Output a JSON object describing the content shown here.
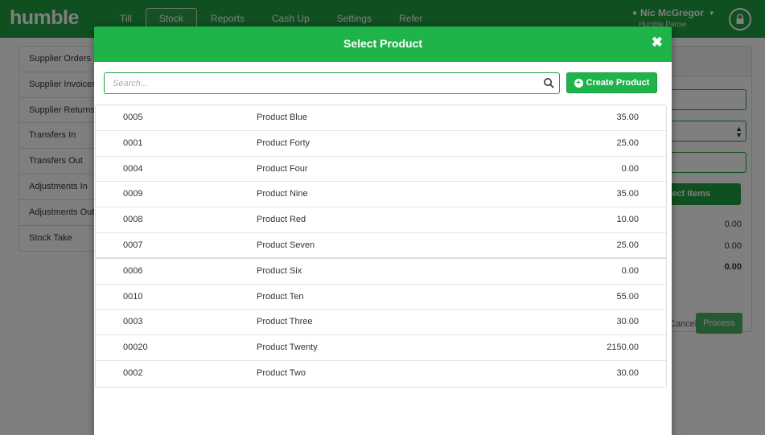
{
  "header": {
    "logo": "humble",
    "tabs": [
      {
        "label": "Till",
        "active": false
      },
      {
        "label": "Stock",
        "active": true
      },
      {
        "label": "Reports",
        "active": false
      },
      {
        "label": "Cash Up",
        "active": false
      },
      {
        "label": "Settings",
        "active": false
      },
      {
        "label": "Refer",
        "active": false
      }
    ],
    "user_name": "Nic McGregor",
    "store_name": "Humble Parow",
    "lock_icon": "lock-icon"
  },
  "sidebar": {
    "items": [
      {
        "label": "Supplier Orders"
      },
      {
        "label": "Supplier Invoices"
      },
      {
        "label": "Supplier Returns"
      },
      {
        "label": "Transfers In"
      },
      {
        "label": "Transfers Out"
      },
      {
        "label": "Adjustments In"
      },
      {
        "label": "Adjustments Out"
      },
      {
        "label": "Stock Take"
      }
    ]
  },
  "right_panel": {
    "select_items_label": "Select Items",
    "totals": [
      "0.00",
      "0.00",
      "0.00"
    ],
    "cancel_label": "Cancel",
    "process_label": "Process"
  },
  "modal": {
    "title": "Select Product",
    "close_icon": "close-icon",
    "search_placeholder": "Search...",
    "search_value": "",
    "create_label": "Create Product",
    "products": [
      {
        "code": "0005",
        "name": "Product Blue",
        "price": "35.00"
      },
      {
        "code": "0001",
        "name": "Product Forty",
        "price": "25.00"
      },
      {
        "code": "0004",
        "name": "Product Four",
        "price": "0.00"
      },
      {
        "code": "0009",
        "name": "Product Nine",
        "price": "35.00"
      },
      {
        "code": "0008",
        "name": "Product Red",
        "price": "10.00"
      },
      {
        "code": "0007",
        "name": "Product Seven",
        "price": "25.00"
      },
      {
        "code": "0006",
        "name": "Product Six",
        "price": "0.00"
      },
      {
        "code": "0010",
        "name": "Product Ten",
        "price": "55.00"
      },
      {
        "code": "0003",
        "name": "Product Three",
        "price": "30.00"
      },
      {
        "code": "00020",
        "name": "Product Twenty",
        "price": "2150.00"
      },
      {
        "code": "0002",
        "name": "Product Two",
        "price": "30.00"
      }
    ]
  },
  "colors": {
    "brand_green": "#1f9e40",
    "modal_green": "#1fb44a",
    "overlay": "rgba(0,0,0,0.5)"
  }
}
